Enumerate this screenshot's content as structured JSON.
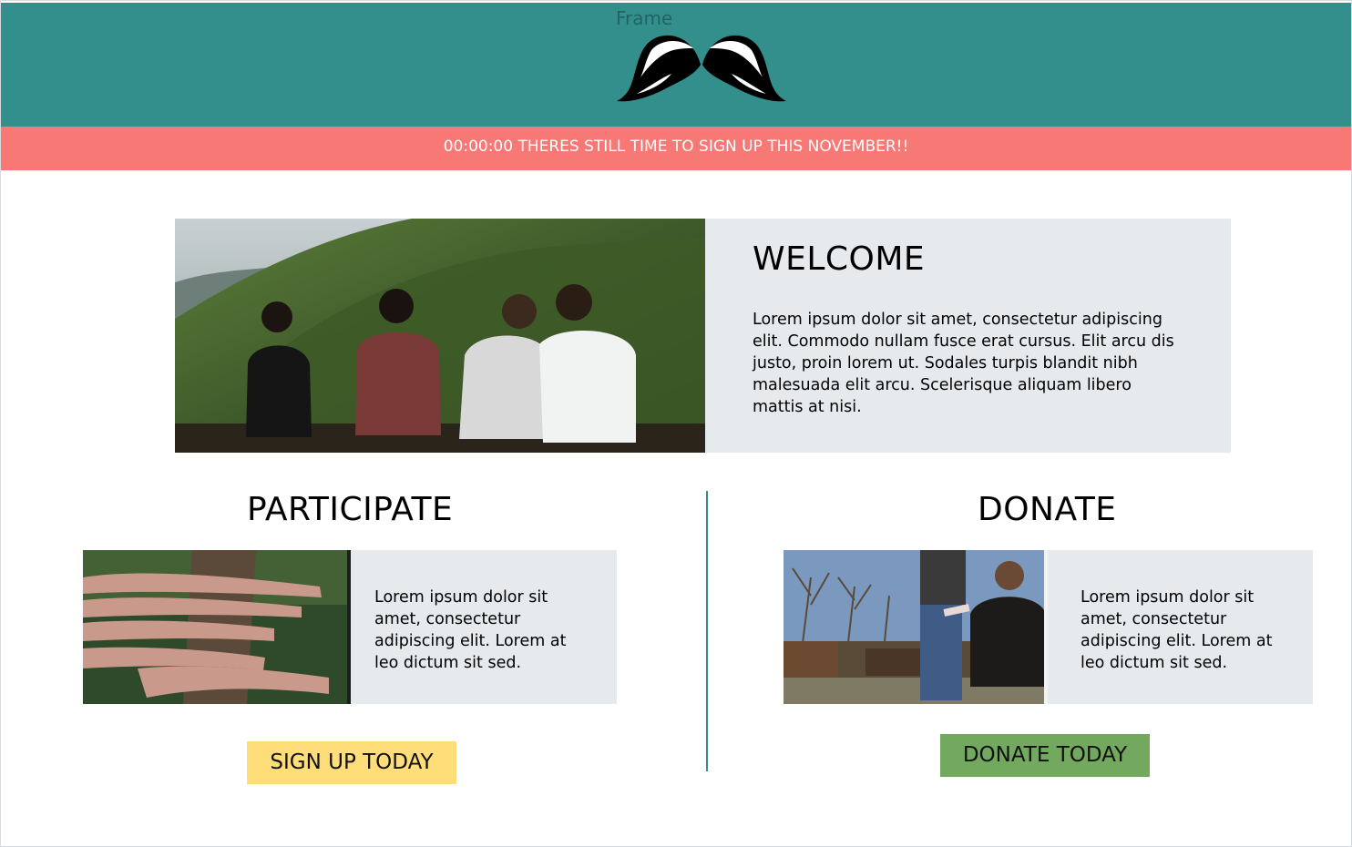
{
  "header": {
    "frame_label": "Frame",
    "logo_icon": "mustache-logo-icon",
    "background_color": "#338f8c"
  },
  "banner": {
    "text": "00:00:00 THERES STILL TIME TO SIGN UP THIS NOVEMBER!!",
    "background_color": "#f87876"
  },
  "welcome": {
    "title": "WELCOME",
    "body": "Lorem ipsum dolor sit amet, consectetur adipiscing elit. Commodo nullam fusce erat cursus. Elit arcu dis justo, proin lorem ut. Sodales turpis blandit nibh malesuada elit arcu. Scelerisque aliquam libero mattis at nisi.",
    "photo": "friends-on-hill-photo"
  },
  "participate": {
    "title": "PARTICIPATE",
    "body": "Lorem ipsum dolor sit amet, consectetur adipiscing elit. Lorem at leo dictum sit sed.",
    "photo": "stacked-hands-photo",
    "button_label": "SIGN UP TODAY",
    "button_color": "#ffde7a"
  },
  "donate": {
    "title": "DONATE",
    "body": "Lorem ipsum dolor sit amet, consectetur adipiscing elit. Lorem at leo dictum sit sed.",
    "photo": "handing-flyer-photo",
    "button_label": "DONATE TODAY",
    "button_color": "#72a95f"
  }
}
